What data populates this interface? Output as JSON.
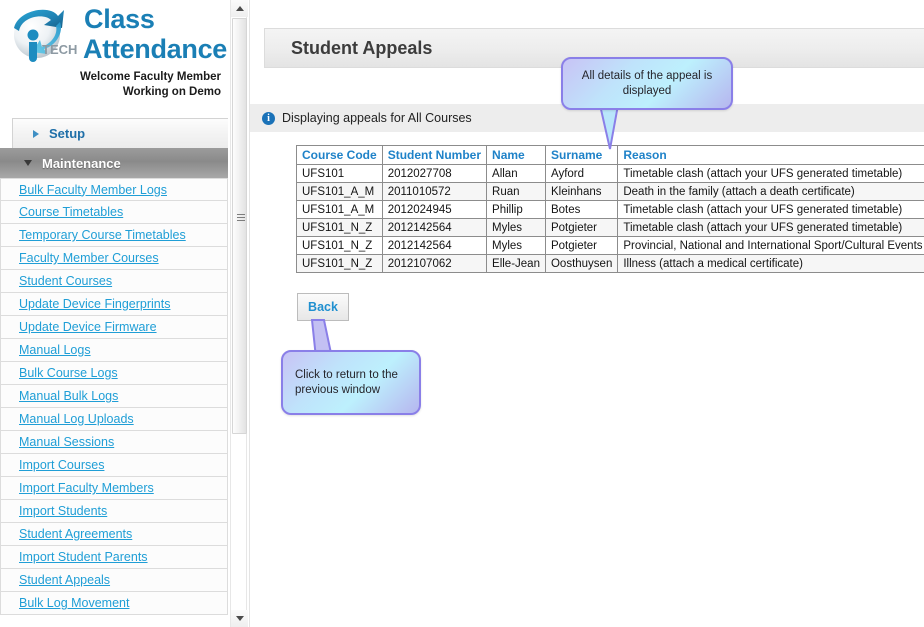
{
  "brand": {
    "logo_icon": "itech-globe-logo",
    "logo_text": "iTECH",
    "title_line1": "Class",
    "title_line2": "Attendance",
    "welcome_line1": "Welcome Faculty Member",
    "welcome_line2": "Working on Demo",
    "accent_color": "#1a7fb5"
  },
  "sidebar": {
    "groups": [
      {
        "label": "Setup",
        "expanded": false,
        "icon": "chevron-right-icon"
      },
      {
        "label": "Maintenance",
        "expanded": true,
        "icon": "chevron-down-icon"
      }
    ],
    "items": [
      {
        "label": "Bulk Faculty Member Logs"
      },
      {
        "label": "Course Timetables"
      },
      {
        "label": "Temporary Course Timetables"
      },
      {
        "label": "Faculty Member Courses"
      },
      {
        "label": "Student Courses"
      },
      {
        "label": "Update Device Fingerprints"
      },
      {
        "label": "Update Device Firmware"
      },
      {
        "label": "Manual Logs"
      },
      {
        "label": "Bulk Course Logs"
      },
      {
        "label": "Manual Bulk Logs"
      },
      {
        "label": "Manual Log Uploads"
      },
      {
        "label": "Manual Sessions"
      },
      {
        "label": "Import Courses"
      },
      {
        "label": "Import Faculty Members"
      },
      {
        "label": "Import Students"
      },
      {
        "label": "Student Agreements"
      },
      {
        "label": "Import Student Parents"
      },
      {
        "label": "Student Appeals"
      },
      {
        "label": "Bulk Log Movement"
      }
    ],
    "link_color": "#1f9ed6"
  },
  "scrollbar": {
    "up_icon": "scroll-up-arrow-icon",
    "down_icon": "scroll-down-arrow-icon",
    "grip_icon": "scrollbar-grip-icon"
  },
  "main": {
    "page_title": "Student Appeals",
    "info_icon": "info-circle-icon",
    "info_glyph": "i",
    "info_text": "Displaying appeals for All Courses",
    "back_label": "Back"
  },
  "table": {
    "columns": [
      "Course Code",
      "Student Number",
      "Name",
      "Surname",
      "Reason"
    ],
    "rows": [
      [
        "UFS101",
        "2012027708",
        "Allan",
        "Ayford",
        "Timetable clash (attach your UFS generated timetable)"
      ],
      [
        "UFS101_A_M",
        "2011010572",
        "Ruan",
        "Kleinhans",
        "Death in the family (attach a death certificate)"
      ],
      [
        "UFS101_A_M",
        "2012024945",
        "Phillip",
        "Botes",
        "Timetable clash (attach your UFS generated timetable)"
      ],
      [
        "UFS101_N_Z",
        "2012142564",
        "Myles",
        "Potgieter",
        "Timetable clash (attach your UFS generated timetable)"
      ],
      [
        "UFS101_N_Z",
        "2012142564",
        "Myles",
        "Potgieter",
        "Provincial, National and International Sport/Cultural Events"
      ],
      [
        "UFS101_N_Z",
        "2012107062",
        "Elle-Jean",
        "Oosthuysen",
        "Illness (attach a medical certificate)"
      ]
    ],
    "header_color": "#1f82c8"
  },
  "callouts": {
    "top": "All details of the appeal is displayed",
    "bottom": "Click to return to the previous window",
    "border_color": "#8a7fe8"
  }
}
